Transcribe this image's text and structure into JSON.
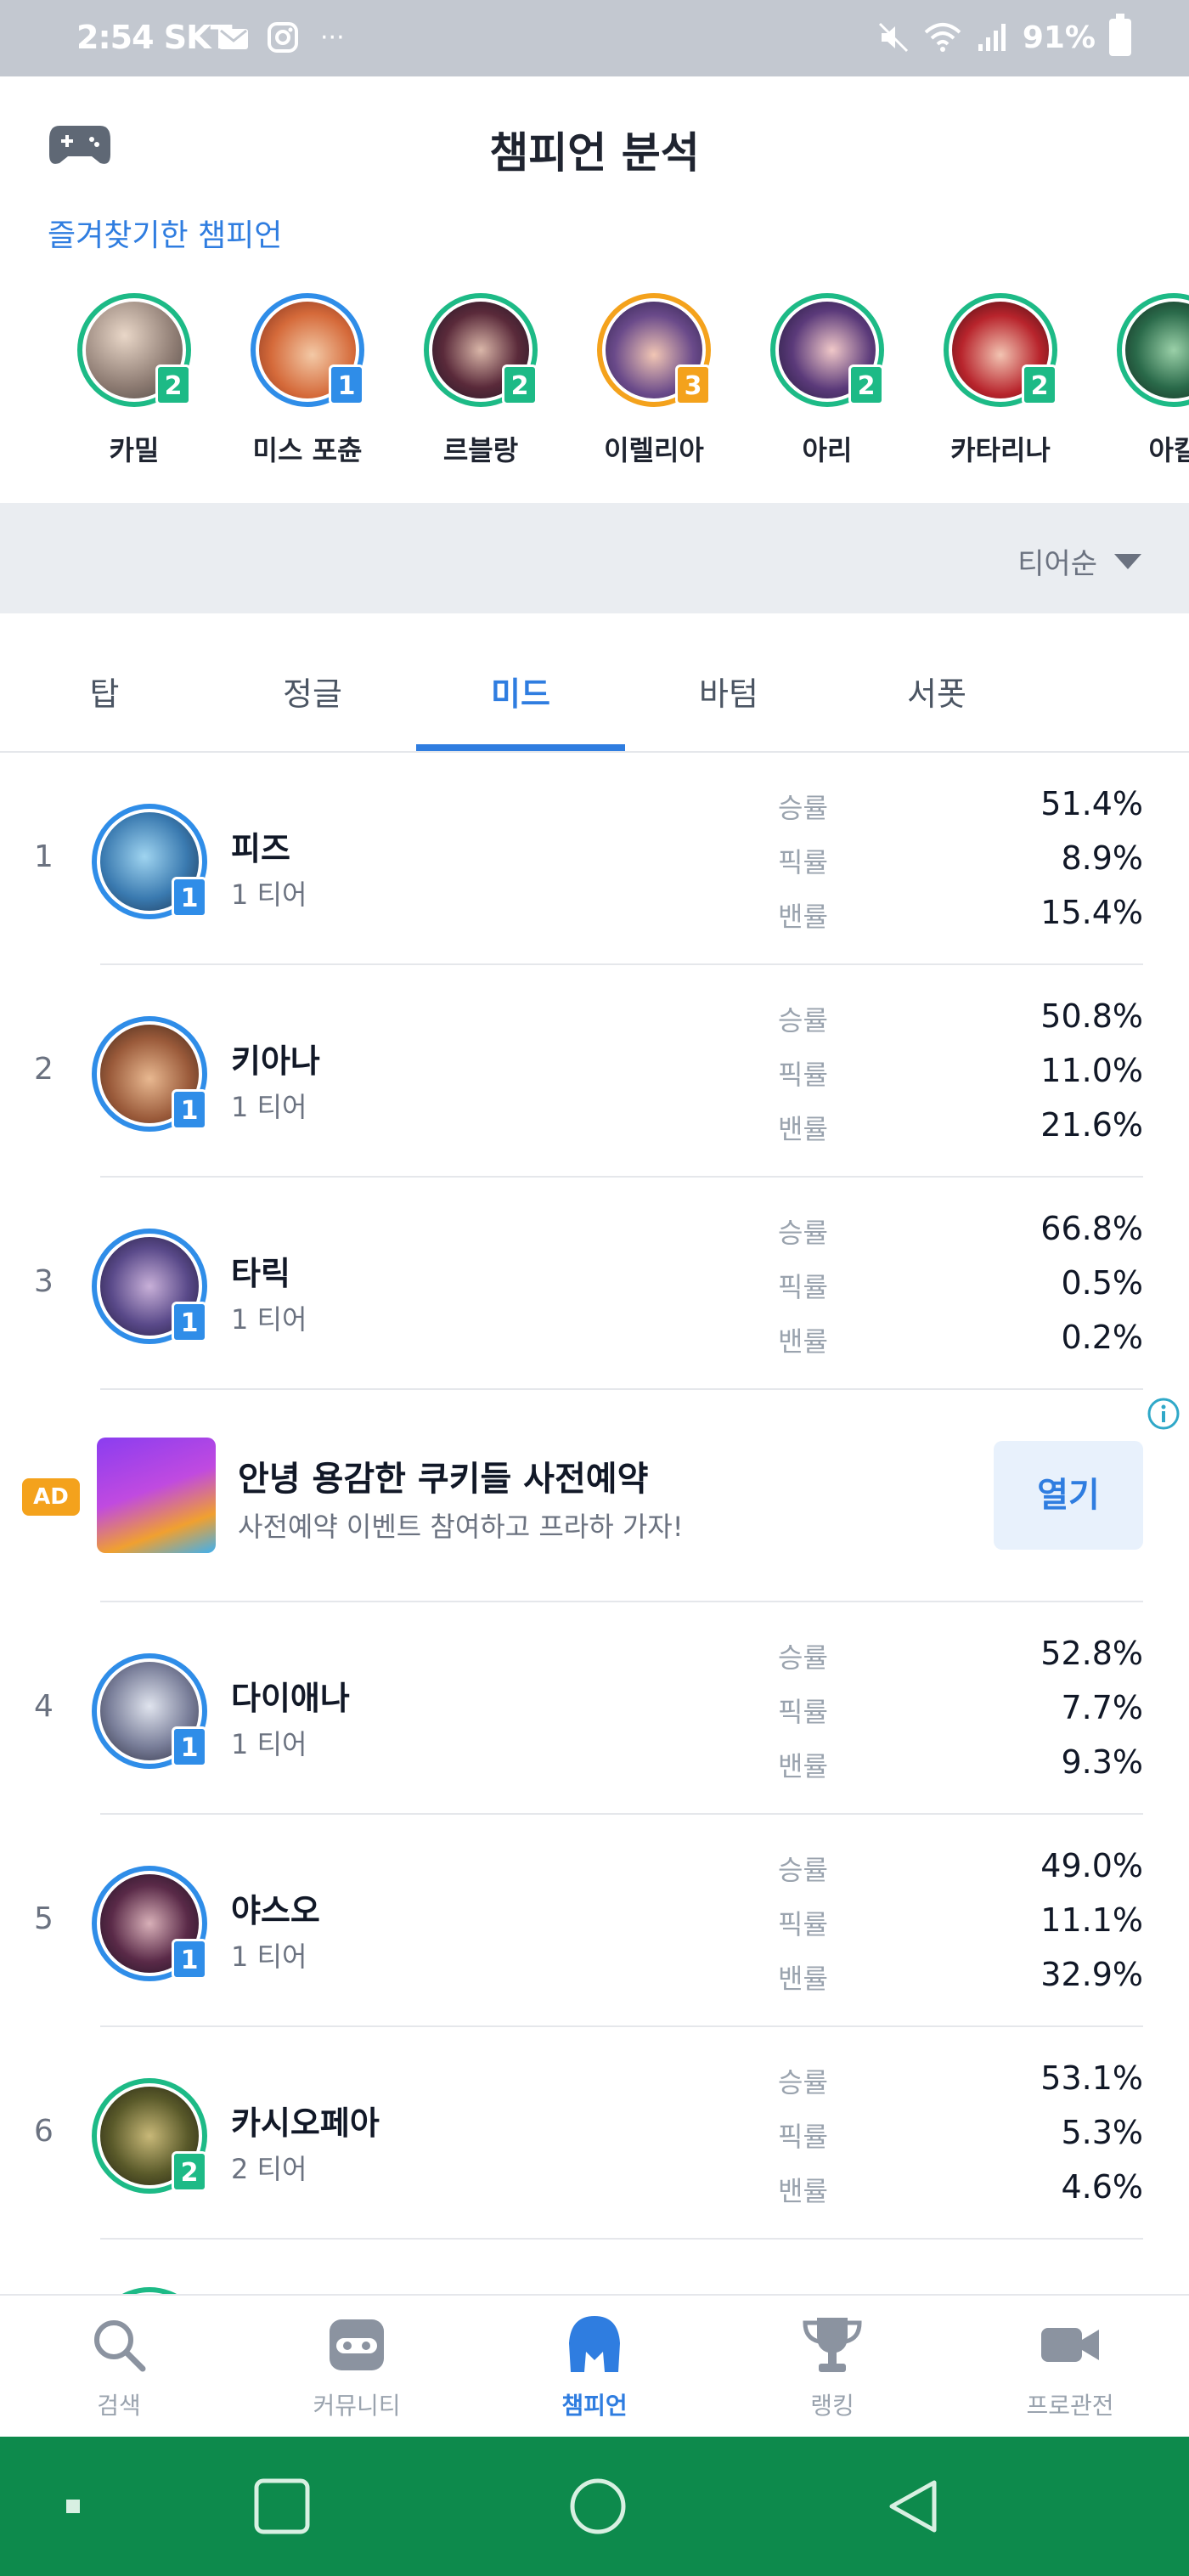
{
  "status_bar": {
    "time": "2:54",
    "carrier": "SKT",
    "battery": "91%"
  },
  "header": {
    "title": "챔피언 분석"
  },
  "favorites": {
    "label": "즐겨찾기한 챔피언",
    "items": [
      {
        "name": "카밀",
        "tier": "2",
        "color": "green"
      },
      {
        "name": "미스 포츈",
        "tier": "1",
        "color": "blue"
      },
      {
        "name": "르블랑",
        "tier": "2",
        "color": "green"
      },
      {
        "name": "이렐리아",
        "tier": "3",
        "color": "gold"
      },
      {
        "name": "아리",
        "tier": "2",
        "color": "green"
      },
      {
        "name": "카타리나",
        "tier": "2",
        "color": "green"
      },
      {
        "name": "아칼",
        "tier": "",
        "color": "green"
      }
    ]
  },
  "sort": {
    "label": "티어순"
  },
  "tabs": [
    {
      "label": "탑"
    },
    {
      "label": "정글"
    },
    {
      "label": "미드"
    },
    {
      "label": "바텀"
    },
    {
      "label": "서폿"
    }
  ],
  "stat_labels": {
    "win": "승률",
    "pick": "픽률",
    "ban": "밴률"
  },
  "champions": [
    {
      "rank": "1",
      "name": "피즈",
      "tier_badge": "1",
      "tier": "1 티어",
      "win": "51.4%",
      "pick": "8.9%",
      "ban": "15.4%"
    },
    {
      "rank": "2",
      "name": "키아나",
      "tier_badge": "1",
      "tier": "1 티어",
      "win": "50.8%",
      "pick": "11.0%",
      "ban": "21.6%"
    },
    {
      "rank": "3",
      "name": "타릭",
      "tier_badge": "1",
      "tier": "1 티어",
      "win": "66.8%",
      "pick": "0.5%",
      "ban": "0.2%"
    },
    {
      "rank": "4",
      "name": "다이애나",
      "tier_badge": "1",
      "tier": "1 티어",
      "win": "52.8%",
      "pick": "7.7%",
      "ban": "9.3%"
    },
    {
      "rank": "5",
      "name": "야스오",
      "tier_badge": "1",
      "tier": "1 티어",
      "win": "49.0%",
      "pick": "11.1%",
      "ban": "32.9%"
    },
    {
      "rank": "6",
      "name": "카시오페아",
      "tier_badge": "2",
      "tier": "2 티어",
      "win": "53.1%",
      "pick": "5.3%",
      "ban": "4.6%"
    }
  ],
  "ad": {
    "badge": "AD",
    "title": "안녕 용감한 쿠키들 사전예약",
    "description": "사전예약 이벤트 참여하고 프라하 가자!",
    "button": "열기"
  },
  "bottom_nav": [
    {
      "label": "검색",
      "icon": "search-icon"
    },
    {
      "label": "커뮤니티",
      "icon": "community-icon"
    },
    {
      "label": "챔피언",
      "icon": "champion-helmet-icon"
    },
    {
      "label": "랭킹",
      "icon": "trophy-icon"
    },
    {
      "label": "프로관전",
      "icon": "video-camera-icon"
    }
  ],
  "colors": {
    "accent": "#2f7de0",
    "tier1": "#2f8de8",
    "tier2": "#1dba86",
    "tier3": "#f4a21c",
    "android_nav": "#0d8a4c"
  }
}
